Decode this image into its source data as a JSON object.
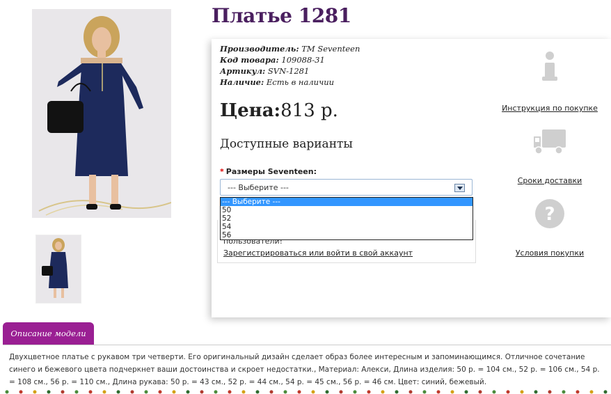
{
  "product": {
    "title": "Платье 1281",
    "info": [
      {
        "label": "Производитель:",
        "value": "ТМ Seventeen"
      },
      {
        "label": "Код товара:",
        "value": "109088-31"
      },
      {
        "label": "Артикул:",
        "value": "SVN-1281"
      },
      {
        "label": "Наличие:",
        "value": "Есть в наличии"
      }
    ],
    "price_label": "Цена:",
    "price_value": "813 р.",
    "variants_title": "Доступные варианты"
  },
  "size_select": {
    "required_mark": "*",
    "label": "Размеры Seventeen:",
    "selected": "--- Выберите ---",
    "options": [
      "--- Выберите ---",
      "50",
      "52",
      "54",
      "56"
    ]
  },
  "hidden_notice": {
    "text": "пользователи!",
    "link": "Зарегистрироваться или войти в свой аккаунт"
  },
  "side_links": {
    "instruction": "Инструкция по покупке",
    "delivery": "Сроки доставки",
    "conditions": "Условия покупки"
  },
  "description": {
    "tab_label": "Описание модели",
    "text": "Двухцветное платье с рукавом три четверти. Его оригинальный дизайн сделает образ более интересным и запоминающимся. Отличное сочетание синего и бежевого цвета подчеркнет ваши достоинства и скроет недостатки., Материал: Алекси, Длина изделия: 50 р. = 104 см., 52 р. = 106 см., 54 р. = 108 см., 56 р. = 110 см., Длина рукава: 50 р. = 43 см., 52 р. = 44 см., 54 р. = 45 см., 56 р. = 46 см. Цвет: синий, бежевый."
  },
  "colors": {
    "title": "#4a1f5f",
    "tab": "#9a1f93",
    "dress": "#1d2a5c",
    "selected_option": "#3296ff"
  }
}
